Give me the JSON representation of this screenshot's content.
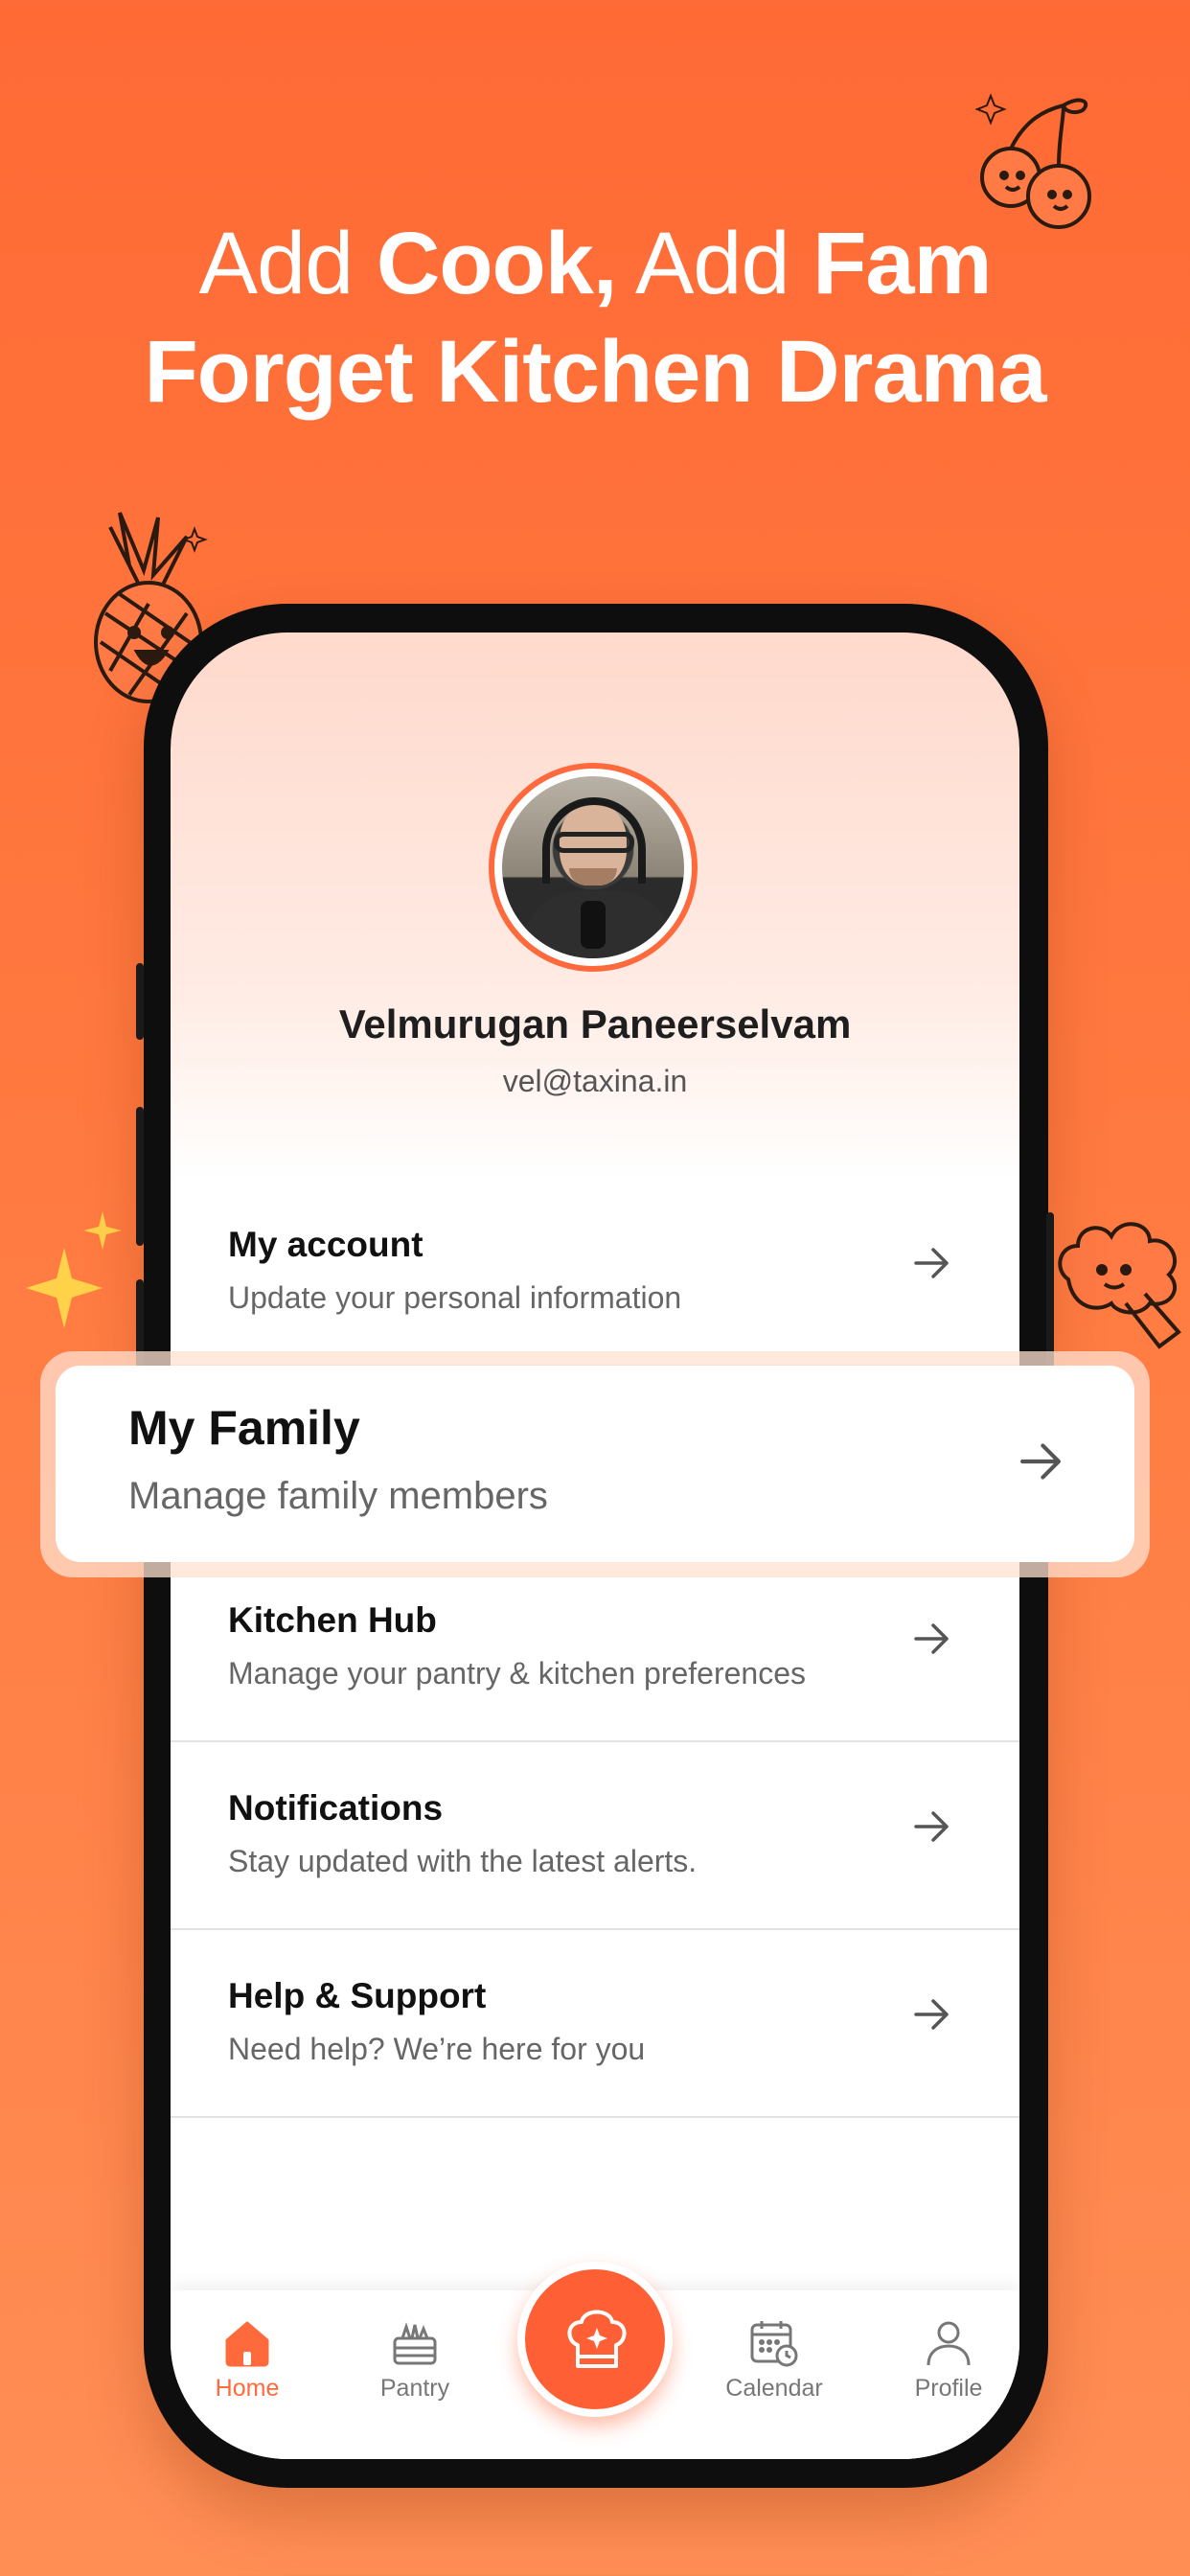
{
  "headline": {
    "line1_a": "Add ",
    "line1_b": "Cook,",
    "line1_c": " Add ",
    "line1_d": "Fam",
    "line2": "Forget Kitchen Drama"
  },
  "profile": {
    "name": "Velmurugan Paneerselvam",
    "email": "vel@taxina.in"
  },
  "menu": {
    "account": {
      "title": "My account",
      "subtitle": "Update your personal information"
    },
    "family": {
      "title": "My Family",
      "subtitle": "Manage family members"
    },
    "kitchen": {
      "title": "Kitchen Hub",
      "subtitle": "Manage your pantry & kitchen preferences"
    },
    "notifications": {
      "title": "Notifications",
      "subtitle": "Stay updated with the latest alerts."
    },
    "help": {
      "title": "Help & Support",
      "subtitle": "Need help? We’re here for you"
    }
  },
  "tabs": {
    "home": "Home",
    "pantry": "Pantry",
    "calendar": "Calendar",
    "profile": "Profile"
  },
  "icons": [
    "home-icon",
    "pantry-icon",
    "chef-hat-icon",
    "calendar-icon",
    "profile-icon",
    "arrow-right-icon"
  ],
  "colors": {
    "brand": "#ff6a3d",
    "background_top": "#ff6a35",
    "background_bottom": "#ff8e55"
  }
}
